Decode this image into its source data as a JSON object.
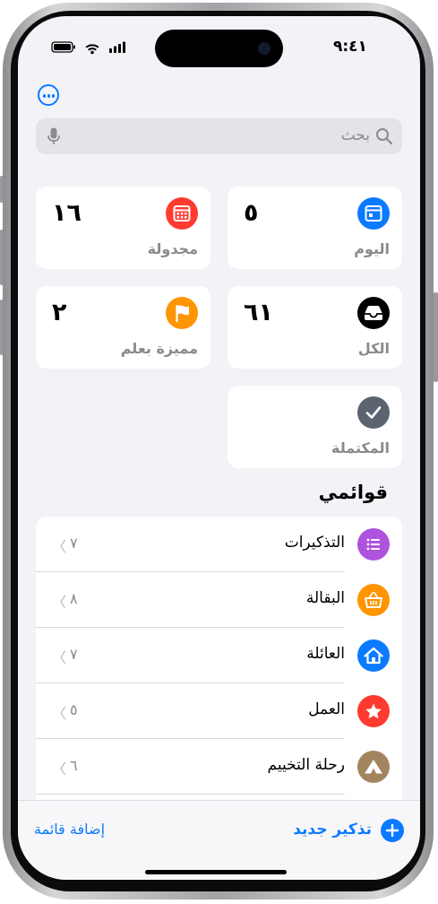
{
  "status_bar": {
    "time": "٩:٤١"
  },
  "search": {
    "placeholder": "بحث"
  },
  "smart_lists": {
    "today": {
      "label": "اليوم",
      "count": "٥",
      "color": "#0a7aff"
    },
    "scheduled": {
      "label": "مجدولة",
      "count": "١٦",
      "color": "#ff3b30"
    },
    "all": {
      "label": "الكل",
      "count": "٦١",
      "color": "#000000"
    },
    "flagged": {
      "label": "مميزة بعلم",
      "count": "٢",
      "color": "#ff9500"
    },
    "completed": {
      "label": "المكتملة",
      "color": "#5b6470"
    }
  },
  "my_lists": {
    "title": "قوائمي",
    "items": [
      {
        "label": "التذكيرات",
        "count": "٧",
        "icon": "list-icon",
        "color": "#af52de"
      },
      {
        "label": "البقالة",
        "count": "٨",
        "icon": "basket-icon",
        "color": "#ff9500"
      },
      {
        "label": "العائلة",
        "count": "٧",
        "icon": "house-icon",
        "color": "#0a7aff"
      },
      {
        "label": "العمل",
        "count": "٥",
        "icon": "star-icon",
        "color": "#ff3b30"
      },
      {
        "label": "رحلة التخييم",
        "count": "٦",
        "icon": "tent-icon",
        "color": "#a2845e"
      }
    ]
  },
  "toolbar": {
    "new_reminder": "تذكير جديد",
    "add_list": "إضافة قائمة"
  }
}
